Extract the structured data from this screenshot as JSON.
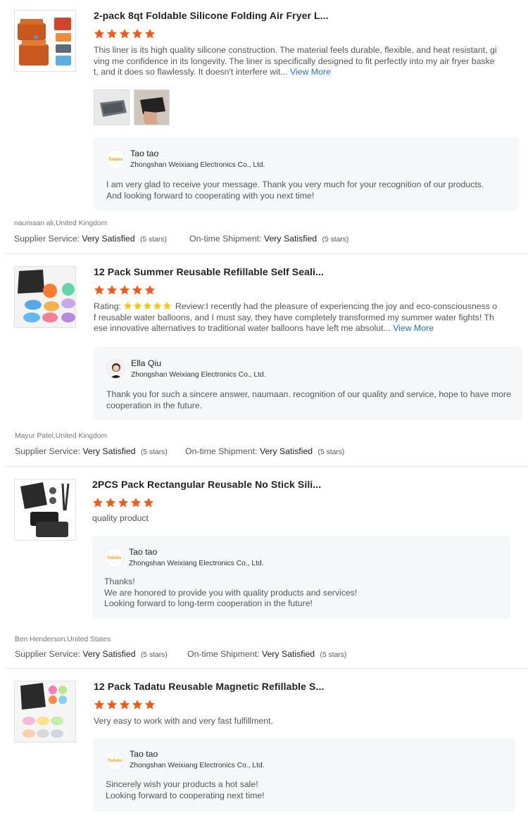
{
  "colors": {
    "star": "#f25a16",
    "inline_star": "#f5c518",
    "link": "#1f6fd0",
    "reply_bg": "#f6f7f9"
  },
  "reviews": [
    {
      "title": "2-pack 8qt Foldable Silicone Folding Air Fryer L...",
      "rating": 5,
      "text": "This liner is its high quality silicone construction. The material feels durable, flexible, and heat resistant, giving me confidence in its longevity. The liner is specifically designed to fit perfectly into my air fryer basket, and it does so flawlessly. It doesn't interfere wit...",
      "view_more": "View More",
      "reply": {
        "name": "Tao tao",
        "company": "Zhongshan Weixiang Electronics Co., Ltd.",
        "text": "I am very glad to receive your message. Thank you very much for your recognition of our products. And looking forward to cooperating with you next time!"
      },
      "reviewer": "naumaan ali,United Kingdom",
      "supplier_service_label": "Supplier Service:",
      "supplier_service_value": "Very Satisfied",
      "supplier_service_stars": "(5 stars)",
      "shipment_label": "On-time Shipment:",
      "shipment_value": "Very Satisfied",
      "shipment_stars": "(5 stars)"
    },
    {
      "title": "12 Pack Summer Reusable Refillable Self Seali...",
      "rating": 5,
      "text_prefix": "Rating:",
      "text": "Review:I recently had the pleasure of experiencing the joy and eco-consciousness of reusable water balloons, and I must say, they have completely transformed my summer water fights! These innovative alternatives to traditional water balloons have left me absolut...",
      "view_more": "View More",
      "reply": {
        "name": "Ella Qiu",
        "company": "Zhongshan Weixiang Electronics Co., Ltd.",
        "text": "Thank you for such a sincere answer,  naumaan. recognition of our quality and service, hope to have more cooperation in the future."
      },
      "reviewer": "Mayur Patel,United Kingdom",
      "supplier_service_label": "Supplier Service:",
      "supplier_service_value": "Very Satisfied",
      "supplier_service_stars": "(5 stars)",
      "shipment_label": "On-time Shipment:",
      "shipment_value": "Very Satisfied",
      "shipment_stars": "(5 stars)"
    },
    {
      "title": "2PCS Pack Rectangular Reusable No Stick Sili...",
      "rating": 5,
      "text": "quality product",
      "reply": {
        "name": "Tao tao",
        "company": "Zhongshan Weixiang Electronics Co., Ltd.",
        "text": "Thanks!\nWe are honored to provide you with quality products and services!\nLooking forward to long-term cooperation in the future!"
      },
      "reviewer": "Ben Henderson,United States",
      "supplier_service_label": "Supplier Service:",
      "supplier_service_value": "Very Satisfied",
      "supplier_service_stars": "(5 stars)",
      "shipment_label": "On-time Shipment:",
      "shipment_value": "Very Satisfied",
      "shipment_stars": "(5 stars)"
    },
    {
      "title": "12 Pack Tadatu Reusable Magnetic Refillable S...",
      "rating": 5,
      "text": "Very easy to work with and very fast fulfillment.",
      "reply": {
        "name": "Tao tao",
        "company": "Zhongshan Weixiang Electronics Co., Ltd.",
        "text": "Sincerely wish your products a hot sale!\nLooking forward to cooperating next time!"
      }
    }
  ]
}
